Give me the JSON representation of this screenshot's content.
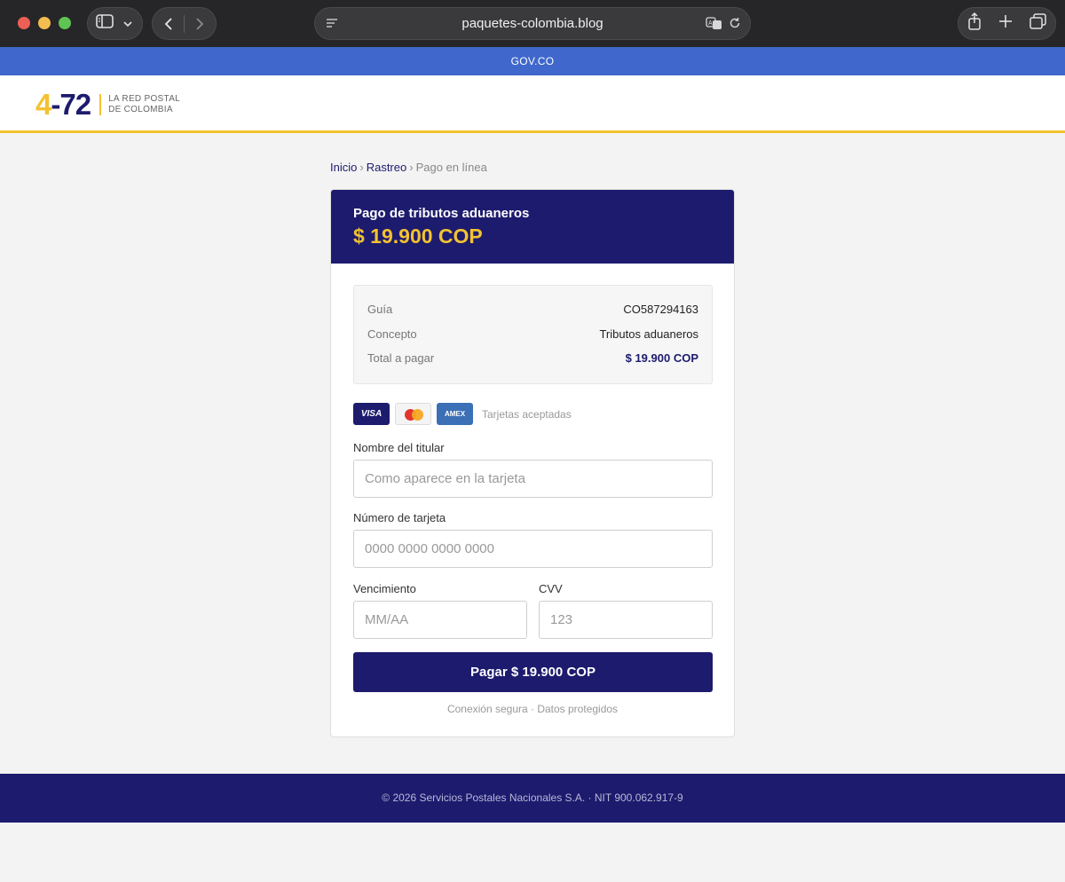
{
  "browser": {
    "url": "paquetes-colombia.blog"
  },
  "govbar": {
    "label": "GOV.CO"
  },
  "header": {
    "logo": {
      "part1": "4",
      "part2": "-72"
    },
    "tagline_line1": "LA RED POSTAL",
    "tagline_line2": "DE COLOMBIA"
  },
  "breadcrumb": {
    "items": [
      "Inicio",
      "Rastreo",
      "Pago en línea"
    ],
    "separator": "›"
  },
  "payment": {
    "title": "Pago de tributos aduaneros",
    "amount": "$ 19.900 COP",
    "summary": [
      {
        "label": "Guía",
        "value": "CO587294163"
      },
      {
        "label": "Concepto",
        "value": "Tributos aduaneros"
      },
      {
        "label": "Total a pagar",
        "value": "$ 19.900 COP"
      }
    ],
    "cards": {
      "visa": "VISA",
      "amex": "AMEX",
      "accepted_label": "Tarjetas aceptadas"
    },
    "form": {
      "holder_label": "Nombre del titular",
      "holder_placeholder": "Como aparece en la tarjeta",
      "number_label": "Número de tarjeta",
      "number_placeholder": "0000 0000 0000 0000",
      "expiry_label": "Vencimiento",
      "expiry_placeholder": "MM/AA",
      "cvv_label": "CVV",
      "cvv_placeholder": "123"
    },
    "pay_button": "Pagar $ 19.900 COP",
    "secure_note": "Conexión segura · Datos protegidos"
  },
  "footer": {
    "text": "© 2026 Servicios Postales Nacionales S.A. · NIT 900.062.917-9"
  },
  "colors": {
    "navy": "#1d1b6e",
    "yellow": "#f2c230",
    "gov_blue": "#3f67cc"
  }
}
